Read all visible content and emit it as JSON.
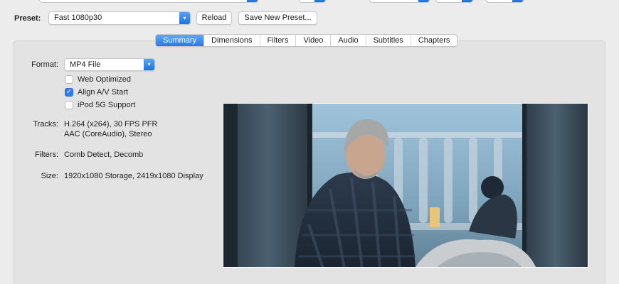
{
  "preset": {
    "label": "Preset:",
    "selected": "Fast 1080p30",
    "reload_label": "Reload",
    "save_label": "Save New Preset..."
  },
  "tabs": [
    {
      "label": "Summary",
      "active": true
    },
    {
      "label": "Dimensions",
      "active": false
    },
    {
      "label": "Filters",
      "active": false
    },
    {
      "label": "Video",
      "active": false
    },
    {
      "label": "Audio",
      "active": false
    },
    {
      "label": "Subtitles",
      "active": false
    },
    {
      "label": "Chapters",
      "active": false
    }
  ],
  "summary": {
    "format_label": "Format:",
    "format_value": "MP4 File",
    "options": [
      {
        "label": "Web Optimized",
        "checked": false
      },
      {
        "label": "Align A/V Start",
        "checked": true
      },
      {
        "label": "iPod 5G Support",
        "checked": false
      }
    ],
    "tracks_label": "Tracks:",
    "tracks_line1": "H.264 (x264), 30 FPS PFR",
    "tracks_line2": "AAC (CoreAudio), Stereo",
    "filters_label": "Filters:",
    "filters_value": "Comb Detect, Decomb",
    "size_label": "Size:",
    "size_value": "1920x1080 Storage, 2419x1080 Display"
  },
  "colors": {
    "accent": "#2d7cf0",
    "window_bg": "#ececec",
    "panel_bg": "#e3e3e3"
  }
}
